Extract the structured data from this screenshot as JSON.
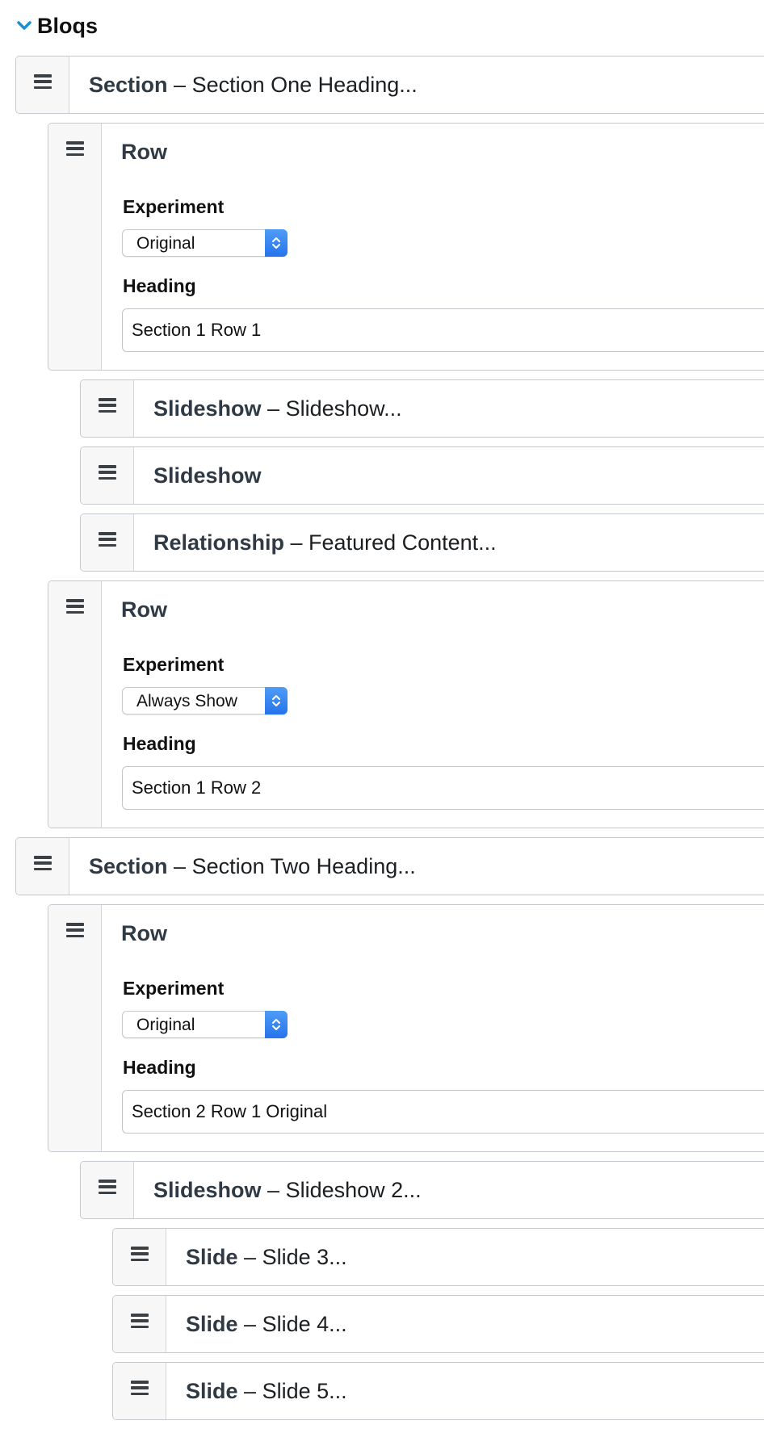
{
  "header": {
    "title": "Bloqs",
    "toggle_icon": "chevron-down-icon",
    "accent": "#1a8fd6"
  },
  "bloqs": [
    {
      "type": "Section",
      "summary": "– Section One Heading..."
    },
    {
      "type": "Row",
      "experiment_label": "Experiment",
      "experiment_value": "Original",
      "heading_label": "Heading",
      "heading_value": "Section 1 Row 1"
    },
    {
      "type": "Slideshow",
      "summary": "– Slideshow..."
    },
    {
      "type": "Slideshow",
      "summary": ""
    },
    {
      "type": "Relationship",
      "summary": "– Featured Content..."
    },
    {
      "type": "Row",
      "experiment_label": "Experiment",
      "experiment_value": "Always Show",
      "heading_label": "Heading",
      "heading_value": "Section 1 Row 2"
    },
    {
      "type": "Section",
      "summary": "– Section Two Heading..."
    },
    {
      "type": "Row",
      "experiment_label": "Experiment",
      "experiment_value": "Original",
      "heading_label": "Heading",
      "heading_value": "Section 2 Row 1 Original"
    },
    {
      "type": "Slideshow",
      "summary": "– Slideshow 2..."
    },
    {
      "type": "Slide",
      "summary": "– Slide 3..."
    },
    {
      "type": "Slide",
      "summary": "– Slide 4..."
    },
    {
      "type": "Slide",
      "summary": "– Slide 5..."
    }
  ]
}
